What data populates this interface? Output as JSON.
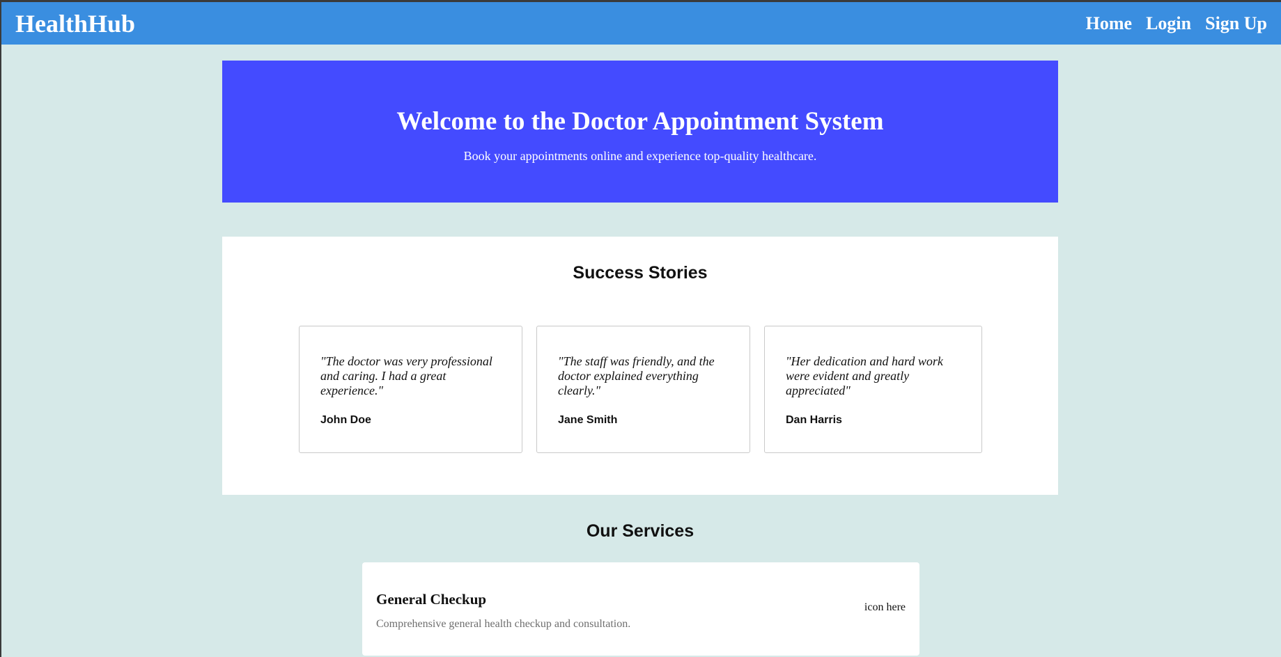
{
  "navbar": {
    "brand": "HealthHub",
    "links": [
      "Home",
      "Login",
      "Sign Up"
    ]
  },
  "hero": {
    "title": "Welcome to the Doctor Appointment System",
    "subtitle": "Book your appointments online and experience top-quality healthcare."
  },
  "stories": {
    "title": "Success Stories",
    "items": [
      {
        "quote": "\"The doctor was very professional and caring. I had a great experience.\"",
        "author": "John Doe"
      },
      {
        "quote": "\"The staff was friendly, and the doctor explained everything clearly.\"",
        "author": "Jane Smith"
      },
      {
        "quote": "\"Her dedication and hard work were evident and greatly appreciated\"",
        "author": "Dan Harris"
      }
    ]
  },
  "services": {
    "title": "Our Services",
    "items": [
      {
        "name": "General Checkup",
        "description": "Comprehensive general health checkup and consultation.",
        "icon": "icon here"
      }
    ]
  },
  "colors": {
    "navbar": "#3a8ee0",
    "hero": "#444bff",
    "page_background": "#d6e9e8"
  }
}
